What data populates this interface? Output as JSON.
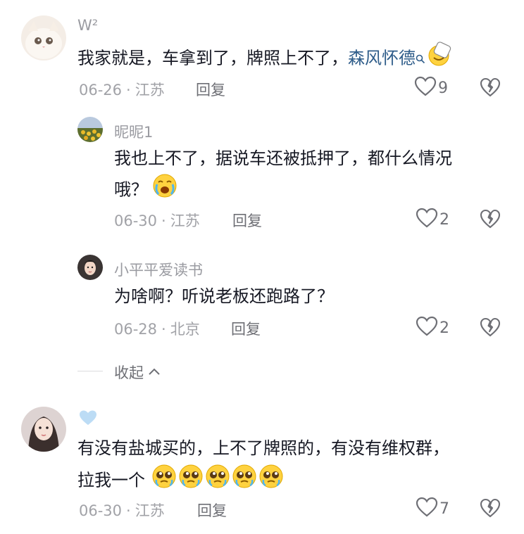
{
  "comments": [
    {
      "username": "W²",
      "text_before_link": "我家就是，车拿到了，牌照上不了，",
      "link_text": "森风怀德",
      "date": "06-26",
      "location": "江苏",
      "reply_label": "回复",
      "likes": "9"
    },
    {
      "username": "昵昵1",
      "text_line1": "我也上不了，据说车还被抵押了，都什么情况",
      "text_line2": "哦？",
      "date": "06-30",
      "location": "江苏",
      "reply_label": "回复",
      "likes": "2"
    },
    {
      "username": "小平平爱读书",
      "text": "为啥啊？听说老板还跑路了？",
      "date": "06-28",
      "location": "北京",
      "reply_label": "回复",
      "likes": "2"
    },
    {
      "username": "",
      "text_line1": "有没有盐城买的，上不了牌照的，有没有维权群，",
      "text_line2": "拉我一个",
      "date": "06-30",
      "location": "江苏",
      "reply_label": "回复",
      "likes": "7"
    }
  ],
  "collapse_label": "收起",
  "meta_separator": "·",
  "colors": {
    "link": "#2f5d8a",
    "meta": "#a1a2a7",
    "text": "#161823",
    "heart_badge": "#bcdcf5"
  },
  "icons": [
    "heart-outline-icon",
    "broken-heart-icon",
    "search-icon",
    "chevron-up-icon",
    "crying-emoji-icon",
    "pleading-emoji-icon",
    "hand-emoji-icon"
  ]
}
